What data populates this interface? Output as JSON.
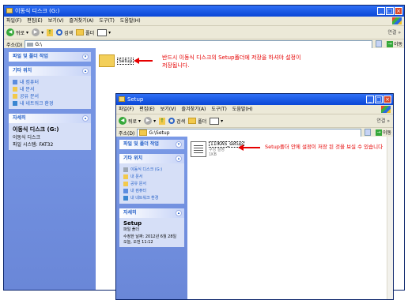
{
  "win1": {
    "title": "이동식 디스크 (G:)",
    "menu": [
      "파일(F)",
      "편집(E)",
      "보기(V)",
      "즐겨찾기(A)",
      "도구(T)",
      "도움말(H)"
    ],
    "back": "뒤로",
    "search": "검색",
    "folders": "폴더",
    "links": "연결",
    "address_label": "주소(D)",
    "address_value": "G:\\",
    "go": "이동",
    "panel_tasks": "파일 및 폴더 작업",
    "panel_places": "기타 위치",
    "places": [
      "내 컴퓨터",
      "내 문서",
      "공유 문서",
      "내 네트워크 환경"
    ],
    "panel_details": "자세히",
    "details_title": "이동식 디스크 (G:)",
    "details_type": "이동식 디스크",
    "details_fs": "파일 시스템: FAT32",
    "folder_name": "Setup",
    "annotation": "반드시 이동식 디스크의 Setup폴더에 저장을 하셔야 설정이 저장됩니다."
  },
  "win2": {
    "title": "Setup",
    "menu": [
      "파일(F)",
      "편집(E)",
      "보기(V)",
      "즐겨찾기(A)",
      "도구(T)",
      "도움말(H)"
    ],
    "back": "뒤로",
    "search": "검색",
    "folders": "폴더",
    "links": "연결",
    "address_label": "주소(D)",
    "address_value": "G:\\Setup",
    "go": "이동",
    "panel_tasks": "파일 및 폴더 작업",
    "panel_places": "기타 위치",
    "places": [
      "이동식 디스크 (G:)",
      "내 문서",
      "공유 문서",
      "내 컴퓨터",
      "내 네트워크 환경"
    ],
    "panel_details": "자세히",
    "details_title": "Setup",
    "details_type": "파일 폴더",
    "details_modified": "수정한 날짜: 2012년 6월 28일 오늘, 오전 11:12",
    "file_name": "11IKAS_setup",
    "file_type": "구성 설정",
    "file_size": "1KB",
    "annotation": "Setup폴더 안에 설정이 저장 된 것을 보실 수 있습니다"
  },
  "colors": {
    "title_blue": "#0a47d6",
    "pane_blue": "#6a87d8",
    "annot_red": "#e60000"
  }
}
